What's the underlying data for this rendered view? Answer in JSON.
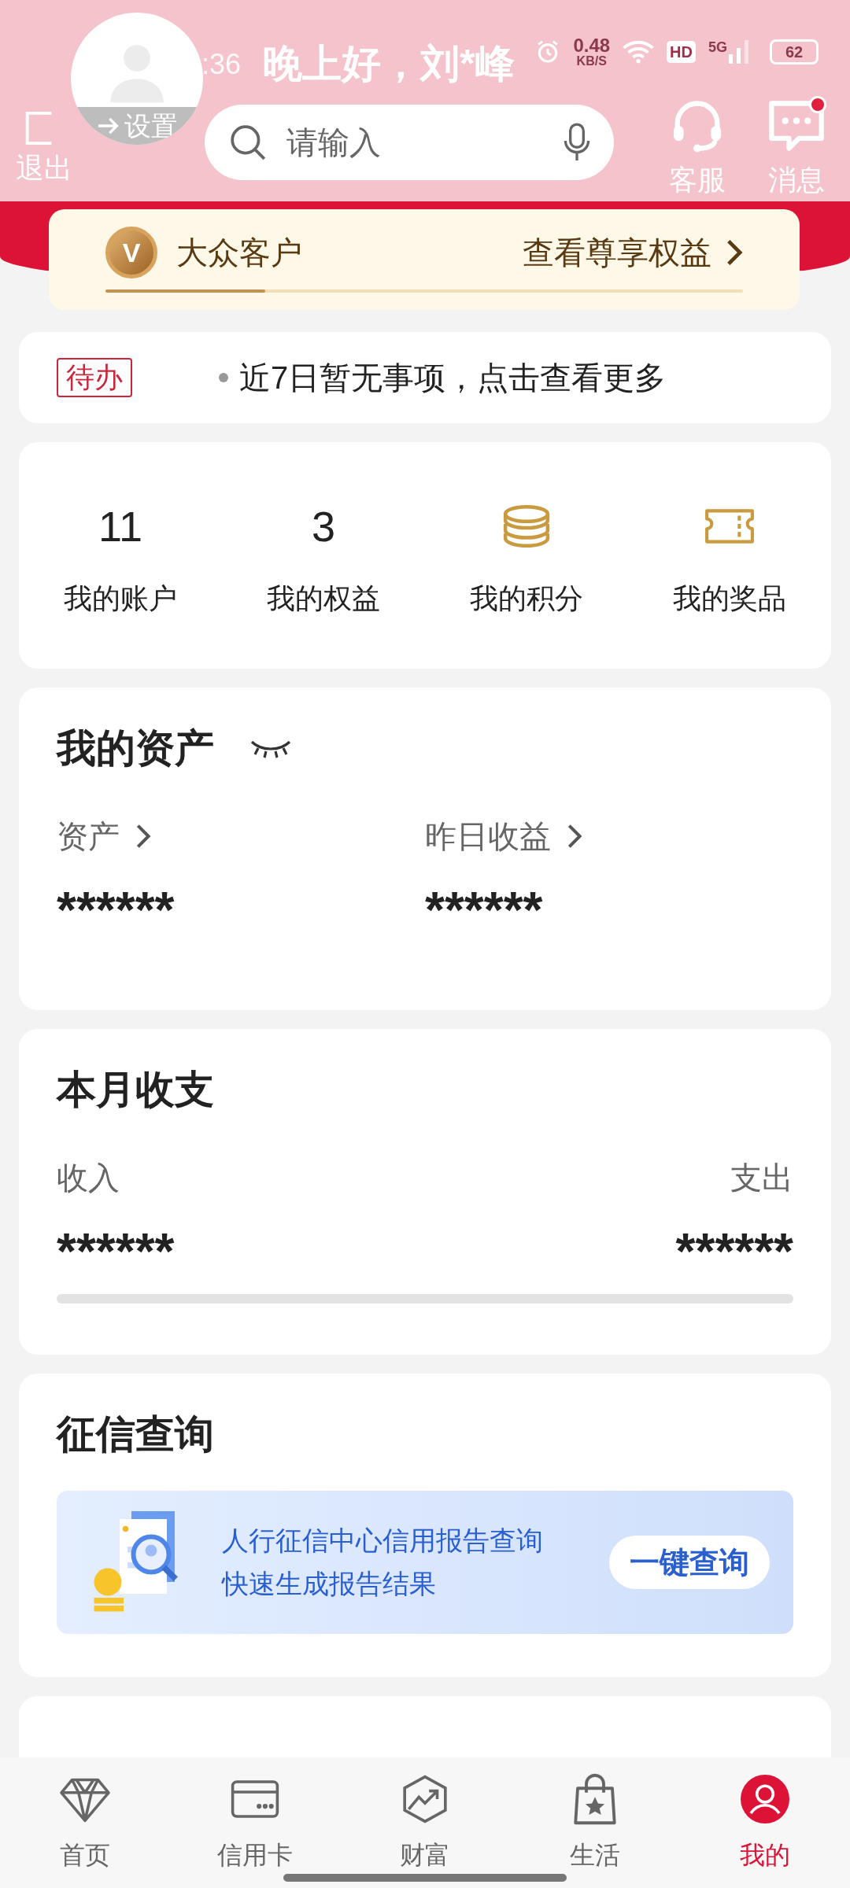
{
  "status_bar": {
    "time": ":36",
    "speed": "0.48",
    "speed_unit": "KB/S",
    "hd": "HD",
    "network": "5G",
    "battery": "62"
  },
  "header": {
    "greeting": "晚上好，刘*峰",
    "settings": "设置",
    "logout": "退出",
    "search": {
      "placeholder": "请输入"
    },
    "actions": [
      {
        "kind": "headset",
        "label": "客服",
        "badge": false
      },
      {
        "kind": "message",
        "label": "消息",
        "badge": true
      }
    ]
  },
  "member": {
    "badge": "V",
    "tier": "大众客户",
    "link": "查看尊享权益",
    "level": 0.25
  },
  "todo": {
    "tag": "待办",
    "message": "近7日暂无事项，点击查看更多"
  },
  "stats": [
    {
      "kind": "number",
      "value": "11",
      "label": "我的账户"
    },
    {
      "kind": "number",
      "value": "3",
      "label": "我的权益"
    },
    {
      "kind": "coins",
      "label": "我的积分"
    },
    {
      "kind": "ticket",
      "label": "我的奖品"
    }
  ],
  "assets": {
    "title": "我的资产",
    "hidden": true,
    "items": [
      {
        "label": "资产",
        "value": "******"
      },
      {
        "label": "昨日收益",
        "value": "******"
      }
    ]
  },
  "monthly": {
    "title": "本月收支",
    "income": {
      "label": "收入",
      "value": "******"
    },
    "expense": {
      "label": "支出",
      "value": "******"
    }
  },
  "credit": {
    "title": "征信查询",
    "line1": "人行征信中心信用报告查询",
    "line2": "快速生成报告结果",
    "button": "一键查询"
  },
  "nav": [
    {
      "kind": "diamond",
      "label": "首页",
      "selected": false
    },
    {
      "kind": "card",
      "label": "信用卡",
      "selected": false
    },
    {
      "kind": "chart",
      "label": "财富",
      "selected": false
    },
    {
      "kind": "bag",
      "label": "生活",
      "selected": false
    },
    {
      "kind": "user",
      "label": "我的",
      "selected": true
    }
  ]
}
